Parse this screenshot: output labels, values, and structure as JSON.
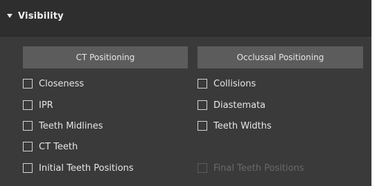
{
  "section": {
    "title": "Visibility"
  },
  "buttons": {
    "ct_positioning": "CT Positioning",
    "occlusal_positioning": "Occlussal Positioning"
  },
  "left_options": [
    {
      "label": "Closeness",
      "checked": false
    },
    {
      "label": "IPR",
      "checked": false
    },
    {
      "label": "Teeth Midlines",
      "checked": false
    },
    {
      "label": "CT Teeth",
      "checked": false
    },
    {
      "label": "Initial Teeth Positions",
      "checked": false
    }
  ],
  "right_options": [
    {
      "label": "Collisions",
      "checked": false
    },
    {
      "label": "Diastemata",
      "checked": false
    },
    {
      "label": "Teeth Widths",
      "checked": false
    },
    {
      "label": "Final Teeth Positions",
      "checked": false,
      "disabled": true
    }
  ]
}
